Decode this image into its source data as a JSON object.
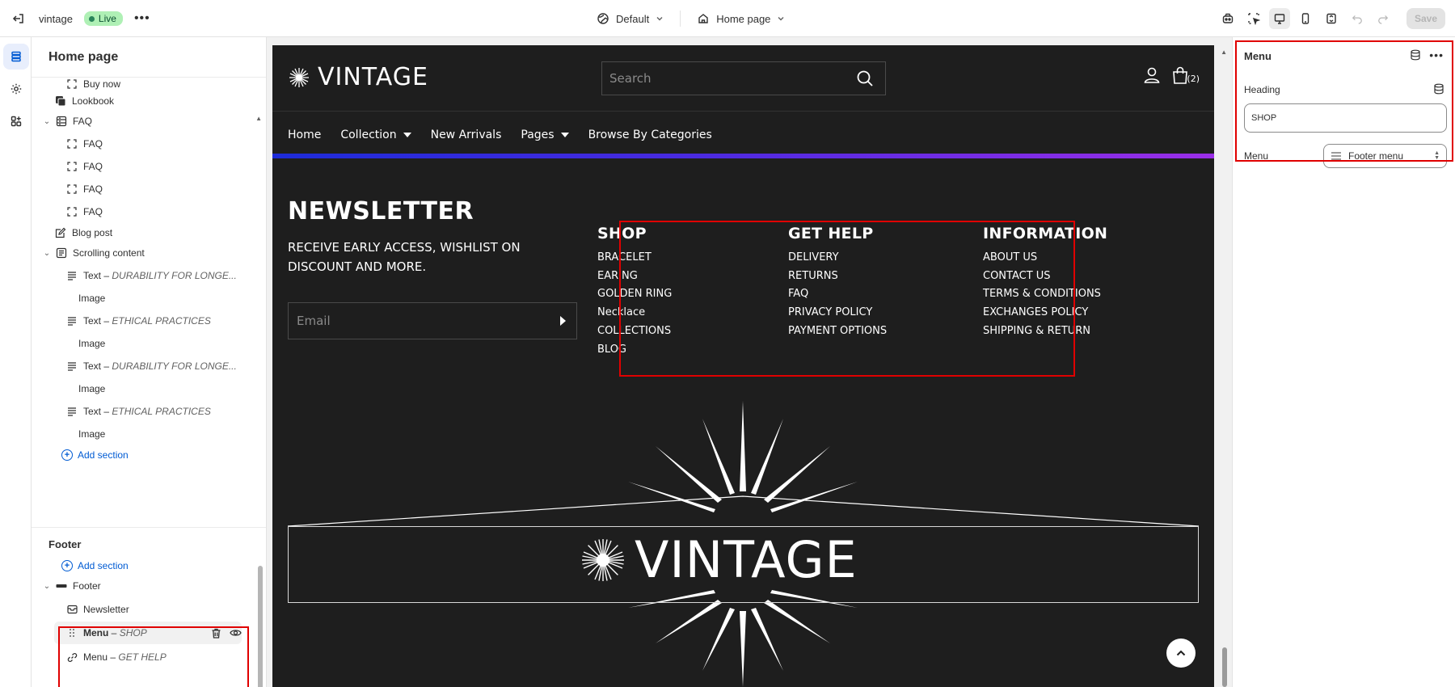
{
  "topbar": {
    "store_name": "vintage",
    "live_label": "Live",
    "theme_selector": "Default",
    "page_selector": "Home page",
    "save_label": "Save"
  },
  "sidebar": {
    "title": "Home page",
    "template_items": [
      {
        "label": "Buy now",
        "level": 2,
        "icon": "block-icon"
      },
      {
        "label": "Lookbook",
        "level": 1,
        "icon": "lookbook-icon"
      },
      {
        "label": "FAQ",
        "level": 1,
        "icon": "faq-section-icon",
        "expanded": true
      },
      {
        "label": "FAQ",
        "level": 2,
        "icon": "block-icon"
      },
      {
        "label": "FAQ",
        "level": 2,
        "icon": "block-icon"
      },
      {
        "label": "FAQ",
        "level": 2,
        "icon": "block-icon"
      },
      {
        "label": "FAQ",
        "level": 2,
        "icon": "block-icon"
      },
      {
        "label": "Blog post",
        "level": 1,
        "icon": "blog-post-icon"
      },
      {
        "label": "Scrolling content",
        "level": 1,
        "icon": "scrolling-content-icon",
        "expanded": true
      },
      {
        "label": "Text",
        "detail": "DURABILITY FOR LONGE...",
        "level": 2,
        "icon": "text-icon"
      },
      {
        "label": "Image",
        "level": 3,
        "icon": ""
      },
      {
        "label": "Text",
        "detail": "ETHICAL PRACTICES",
        "level": 2,
        "icon": "text-icon"
      },
      {
        "label": "Image",
        "level": 3,
        "icon": ""
      },
      {
        "label": "Text",
        "detail": "DURABILITY FOR LONGE...",
        "level": 2,
        "icon": "text-icon"
      },
      {
        "label": "Image",
        "level": 3,
        "icon": ""
      },
      {
        "label": "Text",
        "detail": "ETHICAL PRACTICES",
        "level": 2,
        "icon": "text-icon"
      },
      {
        "label": "Image",
        "level": 3,
        "icon": ""
      }
    ],
    "add_section_label": "Add section",
    "footer_group_label": "Footer",
    "footer_items": [
      {
        "label": "Footer",
        "level": 1,
        "icon": "footer-icon"
      },
      {
        "label": "Newsletter",
        "level": 2,
        "icon": "newsletter-icon"
      },
      {
        "label": "Menu",
        "detail": "SHOP",
        "level": 2,
        "icon": "drag-handle-icon",
        "selected": true
      },
      {
        "label": "Menu",
        "detail": "GET HELP",
        "level": 2,
        "icon": "link-icon"
      }
    ]
  },
  "store": {
    "logo_text": "VINTAGE",
    "search_placeholder": "Search",
    "cart_count": "(2)",
    "nav": [
      {
        "label": "Home",
        "dropdown": false
      },
      {
        "label": "Collection",
        "dropdown": true
      },
      {
        "label": "New Arrivals",
        "dropdown": false
      },
      {
        "label": "Pages",
        "dropdown": true
      },
      {
        "label": "Browse By Categories",
        "dropdown": false
      }
    ],
    "newsletter": {
      "title": "NEWSLETTER",
      "subtitle": "RECEIVE EARLY ACCESS, WISHLIST ON DISCOUNT AND MORE.",
      "email_placeholder": "Email"
    },
    "footer_menus": [
      {
        "heading": "SHOP",
        "items": [
          "BRACELET",
          "EARING",
          "GOLDEN RING",
          "Necklace",
          "COLLECTIONS",
          "BLOG"
        ]
      },
      {
        "heading": "GET HELP",
        "items": [
          "DELIVERY",
          "RETURNS",
          "FAQ",
          "PRIVACY POLICY",
          "PAYMENT OPTIONS"
        ]
      },
      {
        "heading": "INFORMATION",
        "items": [
          "ABOUT US",
          "CONTACT US",
          "TERMS & CONDITIONS",
          "EXCHANGES POLICY",
          "SHIPPING & RETURN"
        ]
      }
    ],
    "banner_logo_text": "VINTAGE"
  },
  "settings_panel": {
    "title": "Menu",
    "heading_label": "Heading",
    "heading_value": "SHOP",
    "menu_label": "Menu",
    "menu_value": "Footer menu"
  },
  "colors": {
    "accent": "#005bd3",
    "highlight": "#e00000",
    "store_bg": "#1e1e1e",
    "live_badge": "#aff0b5"
  }
}
